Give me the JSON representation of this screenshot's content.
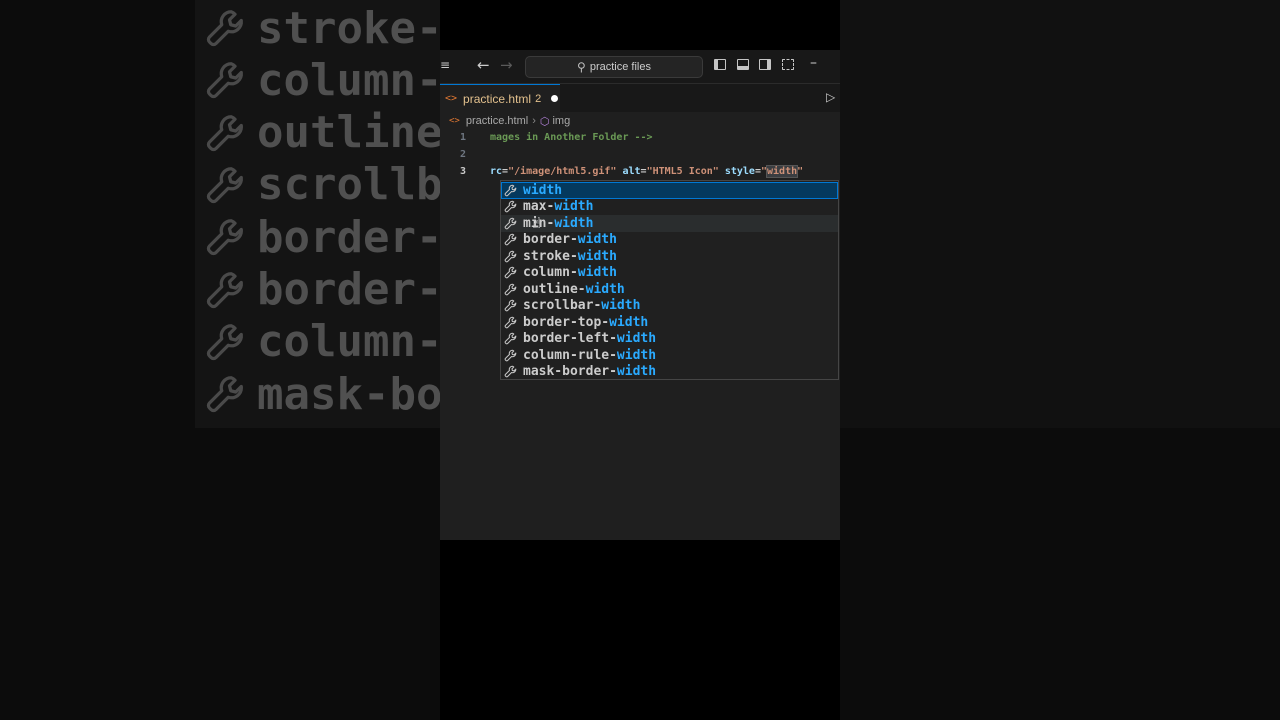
{
  "background": {
    "items": [
      "stroke-",
      "column-",
      "outline",
      "scrollb",
      "border-",
      "border-",
      "column-",
      "mask-bo"
    ]
  },
  "titlebar": {
    "menu_icon": "menu-icon",
    "search_label": "practice files"
  },
  "tab": {
    "name": "practice.html",
    "problems": "2"
  },
  "breadcrumb": {
    "file": "practice.html",
    "symbol": "img"
  },
  "code": {
    "line1_num": "1",
    "line2_num": "2",
    "line3_num": "3",
    "line1_text": "mages in Another Folder -->",
    "line3_part1": "rc",
    "line3_part2": "=",
    "line3_part3": "\"/image/html5.gif\"",
    "line3_part4": " alt",
    "line3_part5": "=",
    "line3_part6": "\"HTML5 Icon\"",
    "line3_part7": " style",
    "line3_part8": "=",
    "line3_part9": "\"",
    "line3_part10": "width",
    "line3_part11": "\""
  },
  "suggestions": [
    {
      "prefix": "",
      "match": "width"
    },
    {
      "prefix": "max-",
      "match": "width"
    },
    {
      "prefix": "min-",
      "match": "width"
    },
    {
      "prefix": "border-",
      "match": "width"
    },
    {
      "prefix": "stroke-",
      "match": "width"
    },
    {
      "prefix": "column-",
      "match": "width"
    },
    {
      "prefix": "outline-",
      "match": "width"
    },
    {
      "prefix": "scrollbar-",
      "match": "width"
    },
    {
      "prefix": "border-top-",
      "match": "width"
    },
    {
      "prefix": "border-left-",
      "match": "width"
    },
    {
      "prefix": "column-rule-",
      "match": "width"
    },
    {
      "prefix": "mask-border-",
      "match": "width"
    }
  ],
  "colors": {
    "accent": "#0078d4",
    "match": "#2aaaff",
    "comment": "#6a9955",
    "string": "#ce9178"
  }
}
